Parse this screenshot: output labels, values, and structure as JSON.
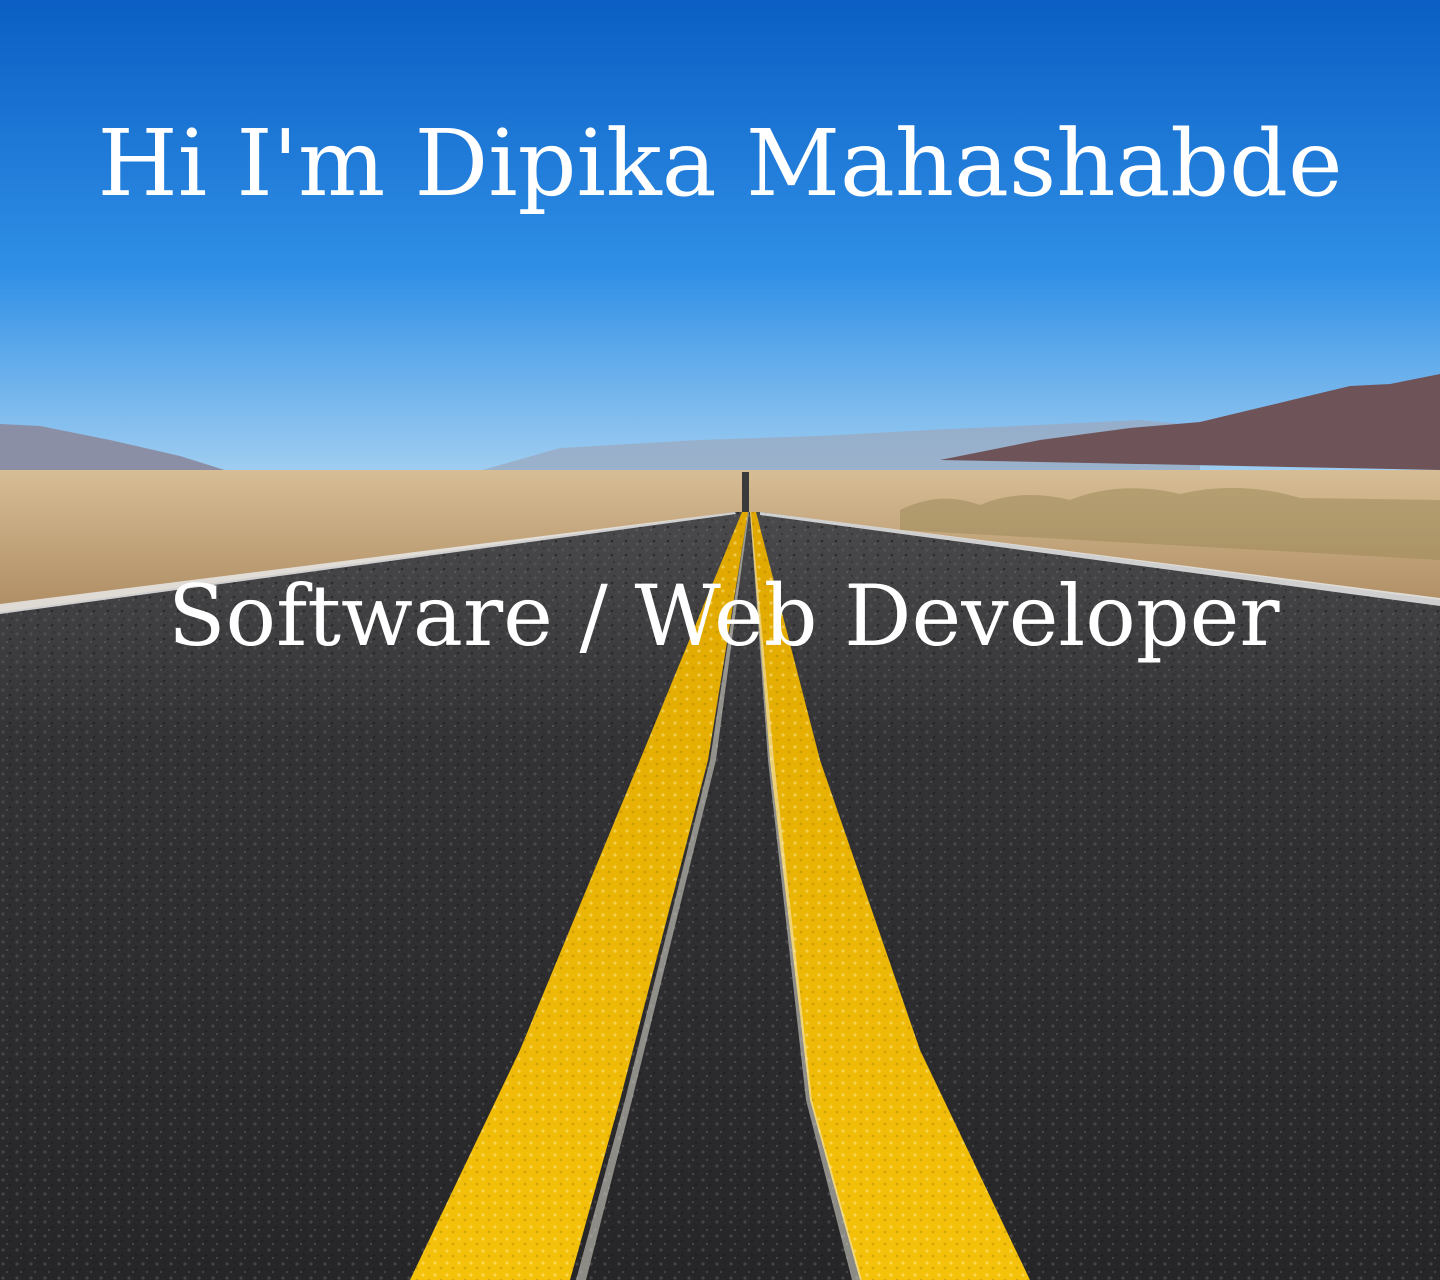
{
  "hero": {
    "greeting": "Hi I'm Dipika Mahashabde",
    "role": "Software / Web Developer"
  },
  "background": {
    "scene": "desert-highway-photo",
    "colors": {
      "sky_top": "#0b5fc4",
      "sky_mid": "#2f8fe6",
      "sky_horizon": "#a9d3f2",
      "mountain_far": "#9aa8bf",
      "mountain_near": "#6e5458",
      "desert": "#c4a57b",
      "asphalt": "#2c2c2e",
      "lane_yellow": "#f2b705",
      "edge_white": "#e8e8e8"
    }
  }
}
